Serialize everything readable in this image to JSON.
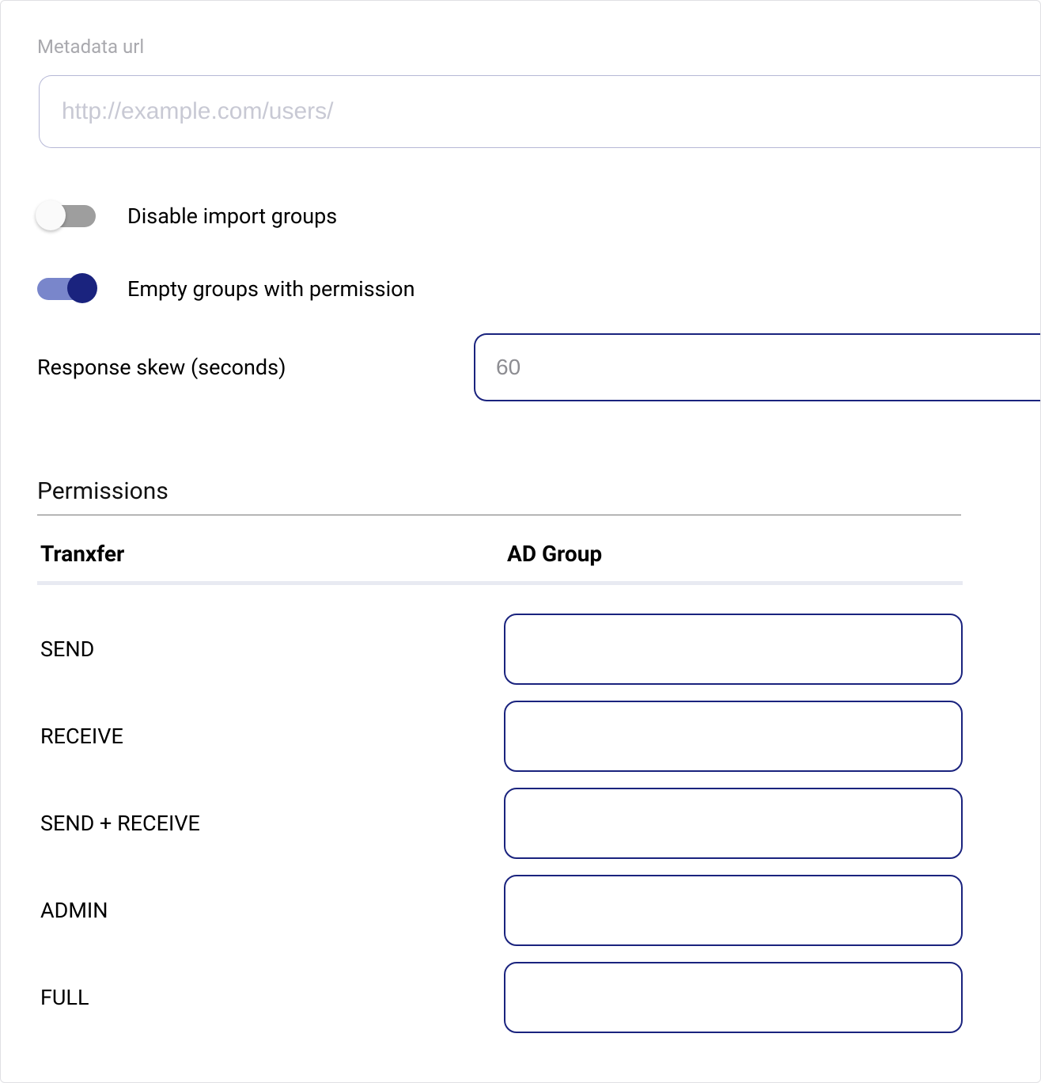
{
  "metadata": {
    "label": "Metadata url",
    "placeholder": "http://example.com/users/",
    "value": ""
  },
  "toggles": {
    "disable_import_groups": {
      "label": "Disable import groups",
      "on": false
    },
    "empty_groups_permission": {
      "label": "Empty groups with permission",
      "on": true
    }
  },
  "response_skew": {
    "label": "Response skew (seconds)",
    "placeholder": "60",
    "value": ""
  },
  "permissions": {
    "heading": "Permissions",
    "columns": {
      "left": "Tranxfer",
      "right": "AD Group"
    },
    "rows": [
      {
        "name": "SEND",
        "value": ""
      },
      {
        "name": "RECEIVE",
        "value": ""
      },
      {
        "name": "SEND + RECEIVE",
        "value": ""
      },
      {
        "name": "ADMIN",
        "value": ""
      },
      {
        "name": "FULL",
        "value": ""
      }
    ]
  }
}
